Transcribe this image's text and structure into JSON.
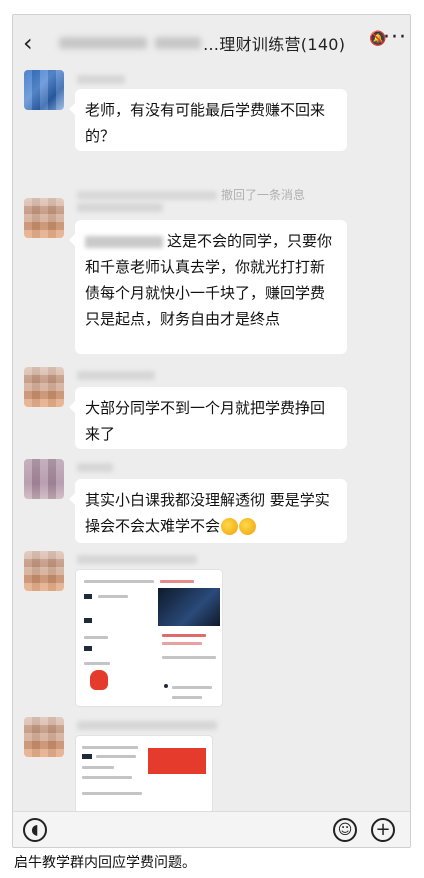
{
  "header": {
    "back_icon": "‹",
    "title": "…理财训练营(140)",
    "more_icon": "···"
  },
  "messages": [
    {
      "text": "老师，有没有可能最后学费赚不回来的？"
    },
    {
      "text": "这是不会的同学，只要你和千意老师认真去学，你就光打打新债每个月就快小一千块了，赚回学费只是起点，财务自由才是终点"
    },
    {
      "text": "大部分同学不到一个月就把学费挣回来了"
    },
    {
      "text": "其实小白课我都没理解透彻 要是学实操会不会太难学不会"
    }
  ],
  "system_notice": "撤回了一条消息",
  "caption": "启牛教学群内回应学费问题。"
}
